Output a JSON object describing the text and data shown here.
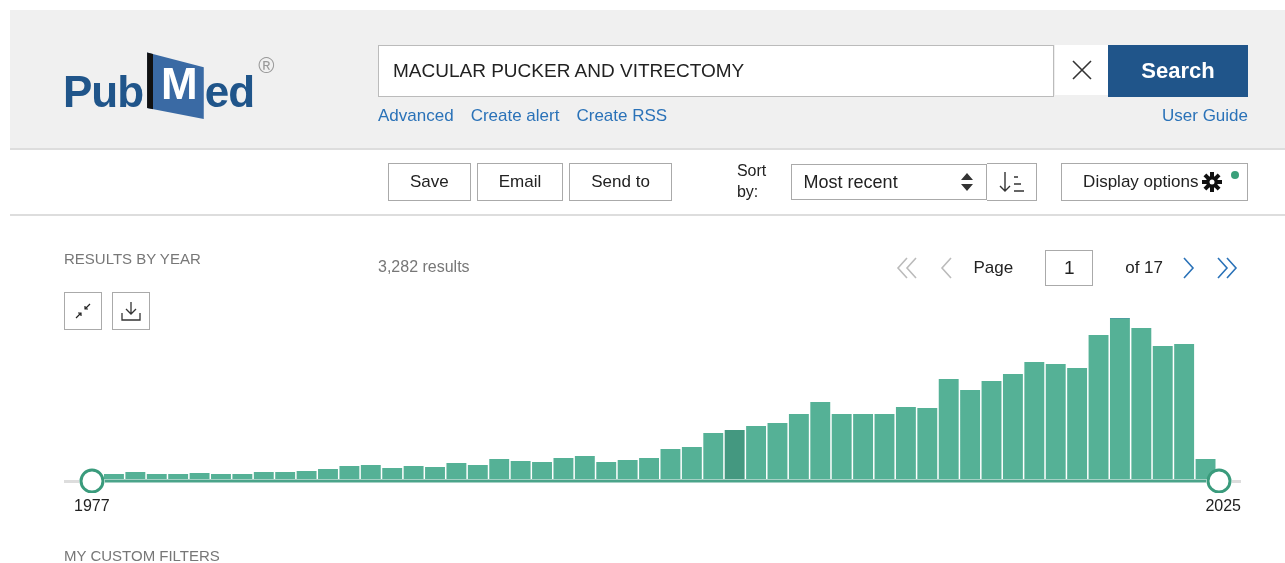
{
  "logo": {
    "left": "Pub",
    "book_letter": "M",
    "right": "ed",
    "mark": "®"
  },
  "search": {
    "value": "MACULAR PUCKER AND VITRECTOMY",
    "button": "Search"
  },
  "links": [
    "Advanced",
    "Create alert",
    "Create RSS"
  ],
  "user_guide": "User Guide",
  "actions": [
    "Save",
    "Email",
    "Send to"
  ],
  "sort": {
    "label": "Sort by:",
    "value": "Most recent"
  },
  "display_options": {
    "label": "Display options",
    "changed": true
  },
  "timeline": {
    "title": "RESULTS BY YEAR",
    "start_year": "1977",
    "end_year": "2025"
  },
  "results_count": "3,282 results",
  "pagination": {
    "label": "Page",
    "value": "1",
    "total": "of 17",
    "back_disabled": true,
    "forward_disabled": false
  },
  "custom_filters": {
    "title": "MY CUSTOM FILTERS"
  }
}
